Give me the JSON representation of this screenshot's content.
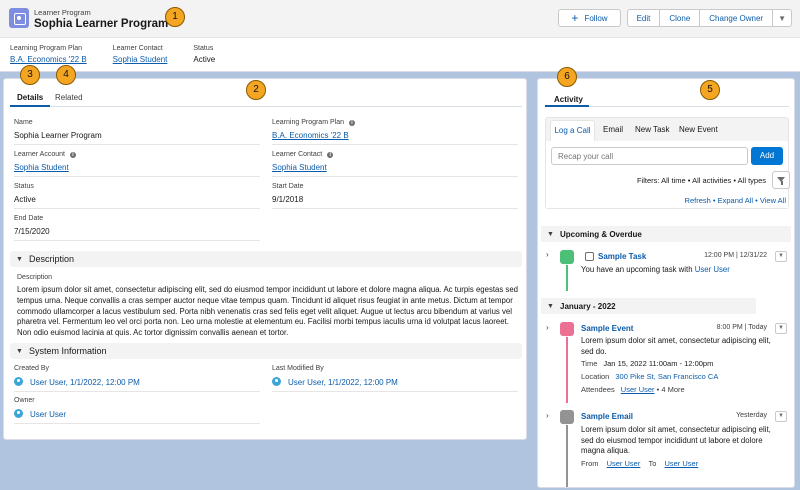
{
  "header": {
    "object_type": "Learner Program",
    "record_title": "Sophia Learner Program",
    "follow_label": "Follow",
    "buttons": [
      "Edit",
      "Clone",
      "Change Owner"
    ],
    "highlights": [
      {
        "label": "Learning Program Plan",
        "value": "B.A. Economics '22 B"
      },
      {
        "label": "Learner Contact",
        "value": "Sophia Student"
      },
      {
        "label": "Status",
        "value": "Active"
      }
    ]
  },
  "callouts": [
    "1",
    "2",
    "3",
    "4",
    "5",
    "6"
  ],
  "tabs": {
    "details": "Details",
    "related": "Related"
  },
  "details": {
    "name_label": "Name",
    "name_value": "Sophia Learner Program",
    "plan_label": "Learning Program Plan",
    "plan_value": "B.A. Economics '22 B",
    "account_label": "Learner Account",
    "account_value": "Sophia Student",
    "contact_label": "Learner Contact",
    "contact_value": "Sophia Student",
    "status_label": "Status",
    "status_value": "Active",
    "start_label": "Start Date",
    "start_value": "9/1/2018",
    "end_label": "End Date",
    "end_value": "7/15/2020"
  },
  "description": {
    "section_title": "Description",
    "label": "Description",
    "text": "Lorem ipsum dolor sit amet, consectetur adipiscing elit, sed do eiusmod tempor incididunt ut labore et dolore magna aliqua. Ac turpis egestas sed tempus urna. Neque convallis a cras semper auctor neque vitae tempus quam. Tincidunt id aliquet risus feugiat in ante metus. Dictum at tempor commodo ullamcorper a lacus vestibulum sed. Porta nibh venenatis cras sed felis eget velit aliquet. Augue ut lectus arcu bibendum at varius vel pharetra vel. Fermentum leo vel orci porta non. Leo urna molestie at elementum eu. Facilisi morbi tempus iaculis urna id volutpat lacus laoreet. Non odio euismod lacinia at quis. Ac tortor dignissim convallis aenean et tortor."
  },
  "system_info": {
    "section_title": "System Information",
    "created_label": "Created By",
    "created_value": "User User, 1/1/2022, 12:00 PM",
    "modified_label": "Last Modified By",
    "modified_value": "User User, 1/1/2022, 12:00 PM",
    "owner_label": "Owner",
    "owner_value": "User User"
  },
  "activity": {
    "tab_label": "Activity",
    "composer_tabs": [
      "Log a Call",
      "Email",
      "New Task",
      "New Event"
    ],
    "recap_placeholder": "Recap your call",
    "add_label": "Add",
    "filters_text": "Filters: All time • All activities • All types",
    "links": [
      "Refresh",
      "Expand All",
      "View All"
    ],
    "upcoming_title": "Upcoming & Overdue",
    "task": {
      "title": "Sample Task",
      "meta": "12:00 PM | 12/31/22",
      "body_prefix": "You have an upcoming task with",
      "body_link": "User User"
    },
    "month_title": "January - 2022",
    "event": {
      "title": "Sample Event",
      "meta": "8:00 PM | Today",
      "body": "Lorem ipsum dolor sit amet, consectetur adipiscing elit, sed do.",
      "time_label": "Time",
      "time_value": "Jan 15, 2022 11:00am - 12:00pm",
      "location_label": "Location",
      "location_value": "300 Pike St, San Francisco CA",
      "attendees_label": "Attendees",
      "attendees_value": "User User",
      "attendees_more": "• 4 More"
    },
    "email": {
      "title": "Sample Email",
      "meta": "Yesterday",
      "body": "Lorem ipsum dolor sit amet, consectetur adipiscing elit, sed do eiusmod tempor incididunt ut labore et dolore magna aliqua.",
      "from_label": "From",
      "from_value": "User User",
      "to_label": "To",
      "to_value": "User User"
    }
  },
  "colors": {
    "brand": "#0176d3",
    "link": "#0b5cab",
    "callout": "#f4a522",
    "task": "#4bc076",
    "event": "#eb7092",
    "email": "#939393"
  }
}
